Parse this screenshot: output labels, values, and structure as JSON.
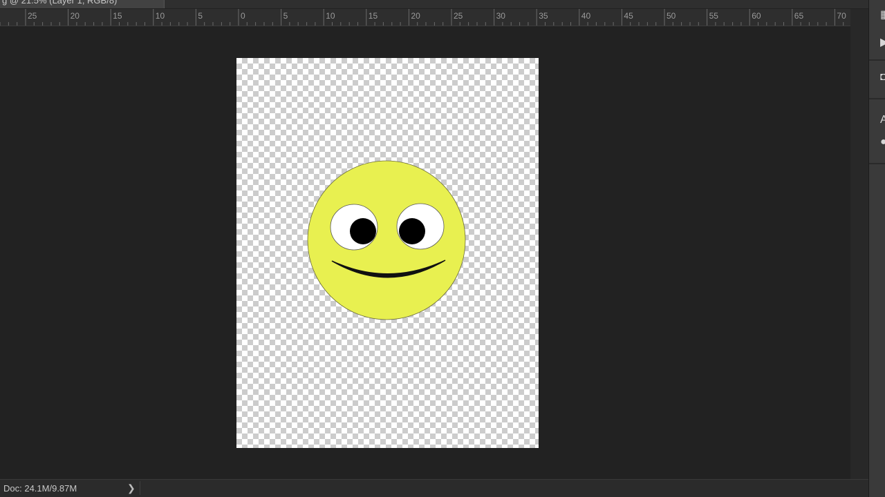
{
  "document_tab": {
    "title": "g @ 21.5% (Layer 1, RGB/8)"
  },
  "ruler": {
    "labels": [
      "25",
      "20",
      "15",
      "10",
      "5",
      "0",
      "5",
      "10",
      "15",
      "20",
      "25",
      "30",
      "35",
      "40",
      "45",
      "50",
      "55",
      "60",
      "65",
      "70"
    ]
  },
  "canvas": {
    "artwork": "smiley-face",
    "colors": {
      "face": "#e8f050",
      "eye_white": "#ffffff",
      "pupil": "#000000",
      "workspace": "#222222"
    }
  },
  "status_bar": {
    "doc_info": "Doc: 24.1M/9.87M",
    "arrow": "❯"
  },
  "right_panel": {
    "icons": [
      "libraries-icon",
      "play-icon",
      "3d-cube-icon",
      "character-icon",
      "bullet-icon"
    ]
  }
}
